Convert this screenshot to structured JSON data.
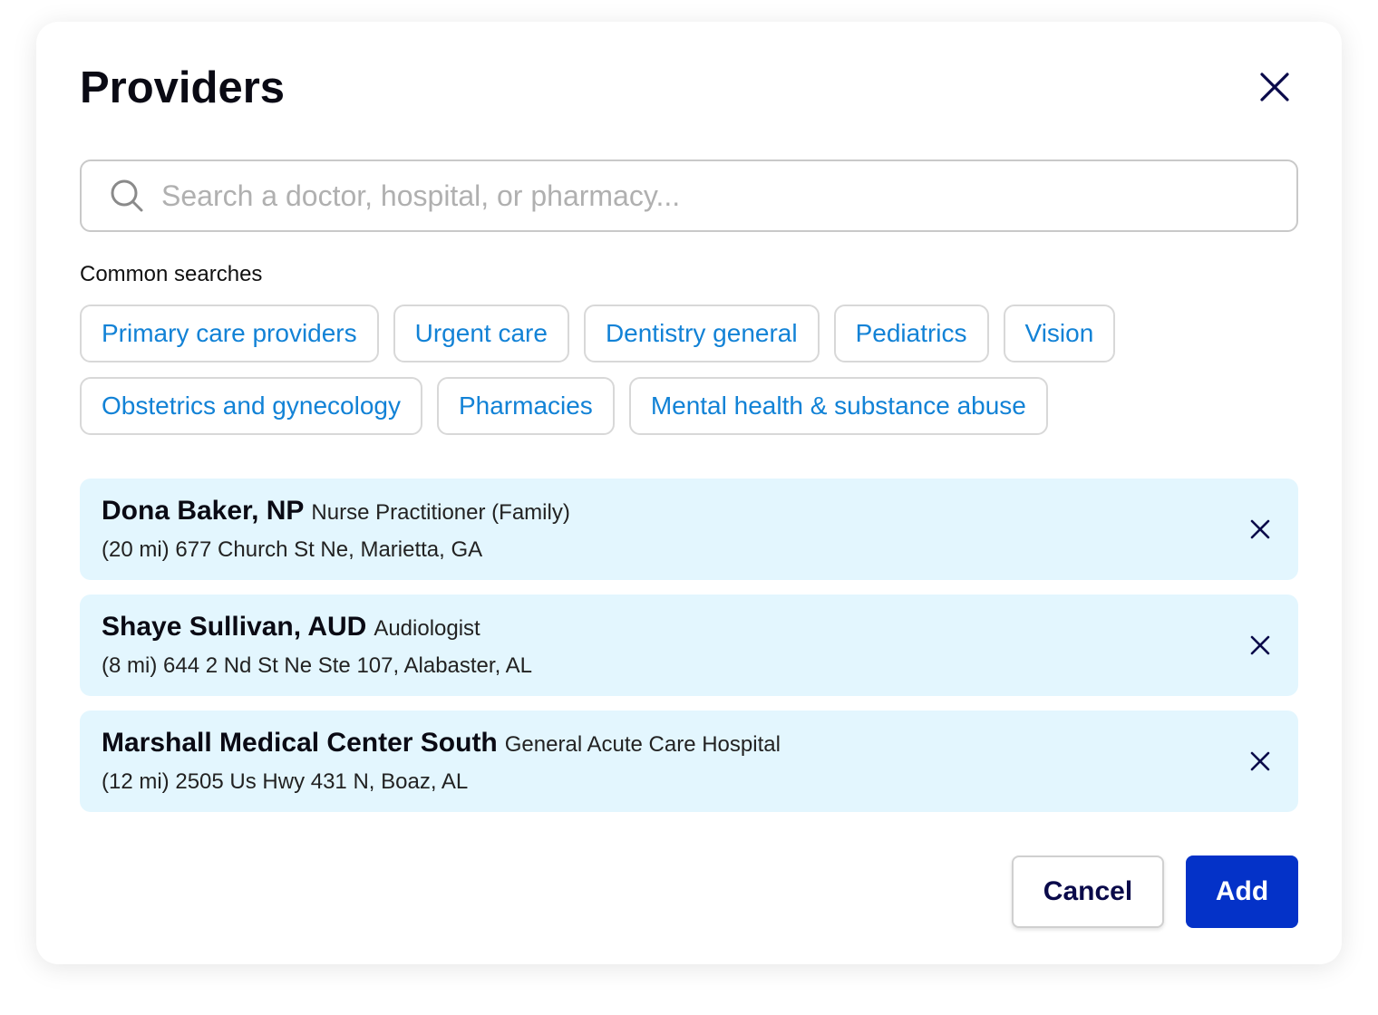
{
  "dialog": {
    "title": "Providers",
    "close_icon": "close-icon"
  },
  "search": {
    "placeholder": "Search a doctor, hospital, or pharmacy...",
    "value": "",
    "icon": "search-icon"
  },
  "common_searches": {
    "label": "Common searches",
    "chips": [
      "Primary care providers",
      "Urgent care",
      "Dentistry general",
      "Pediatrics",
      "Vision",
      "Obstetrics and gynecology",
      "Pharmacies",
      "Mental health & substance abuse"
    ]
  },
  "providers": [
    {
      "name": "Dona Baker, NP",
      "type": "Nurse Practitioner (Family)",
      "address": "(20 mi) 677 Church St Ne, Marietta, GA"
    },
    {
      "name": "Shaye Sullivan, AUD",
      "type": "Audiologist",
      "address": "(8 mi) 644 2 Nd St Ne Ste 107, Alabaster, AL"
    },
    {
      "name": "Marshall Medical Center South",
      "type": "General Acute Care Hospital",
      "address": "(12 mi) 2505 Us Hwy 431 N, Boaz, AL"
    }
  ],
  "footer": {
    "cancel_label": "Cancel",
    "add_label": "Add"
  },
  "colors": {
    "chip_text": "#1282d6",
    "provider_bg": "#e3f6fe",
    "primary_button": "#0432c8",
    "icon_dark": "#0a0a4a"
  }
}
